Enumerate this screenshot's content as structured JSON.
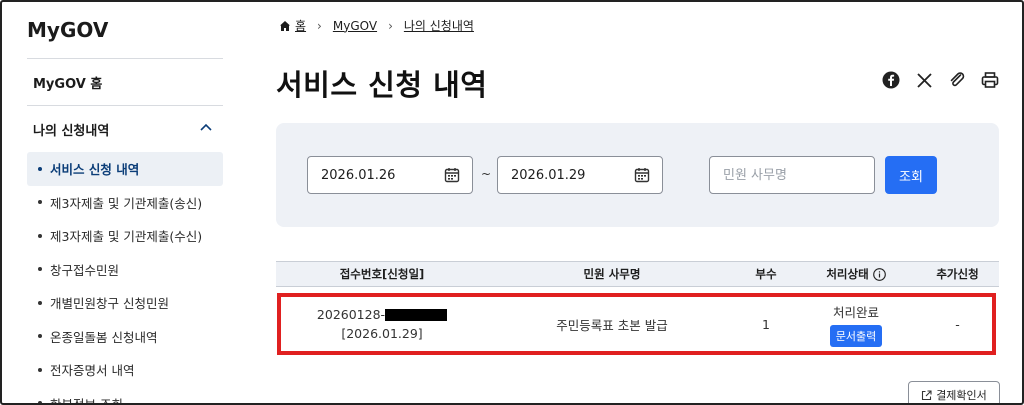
{
  "sidebar": {
    "brand": "MyGOV",
    "home_label": "MyGOV 홈",
    "section_label": "나의 신청내역",
    "items": [
      {
        "label": "서비스 신청 내역"
      },
      {
        "label": "제3자제출 및 기관제출(송신)"
      },
      {
        "label": "제3자제출 및 기관제출(수신)"
      },
      {
        "label": "창구접수민원"
      },
      {
        "label": "개별민원창구 신청민원"
      },
      {
        "label": "온종일돌봄 신청내역"
      },
      {
        "label": "전자증명서 내역"
      },
      {
        "label": "한부정보 조회"
      }
    ]
  },
  "breadcrumb": {
    "home": "홈",
    "level1": "MyGOV",
    "level2": "나의 신청내역"
  },
  "page": {
    "title": "서비스 신청 내역"
  },
  "share_icons": [
    "facebook-icon",
    "x-icon",
    "link-icon",
    "print-icon"
  ],
  "search": {
    "start_date": "2026.01.26",
    "separator": "~",
    "end_date": "2026.01.29",
    "name_placeholder": "민원 사무명",
    "name_value": "",
    "submit_label": "조회"
  },
  "table": {
    "headers": {
      "receipt": "접수번호[신청일]",
      "name": "민원 사무명",
      "copies": "부수",
      "status": "처리상태",
      "extra": "추가신청"
    },
    "rows": [
      {
        "receipt_no": "20260128-",
        "receipt_date": "[2026.01.29]",
        "name": "주민등록표 초본 발급",
        "copies": "1",
        "status": "처리완료",
        "print_label": "문서출력",
        "extra": "-"
      }
    ]
  },
  "payment_confirm_label": "결제확인서",
  "colors": {
    "accent": "#256ef4",
    "panel": "#eef1f6",
    "highlight": "#e02020",
    "active_text": "#0b3d78"
  }
}
